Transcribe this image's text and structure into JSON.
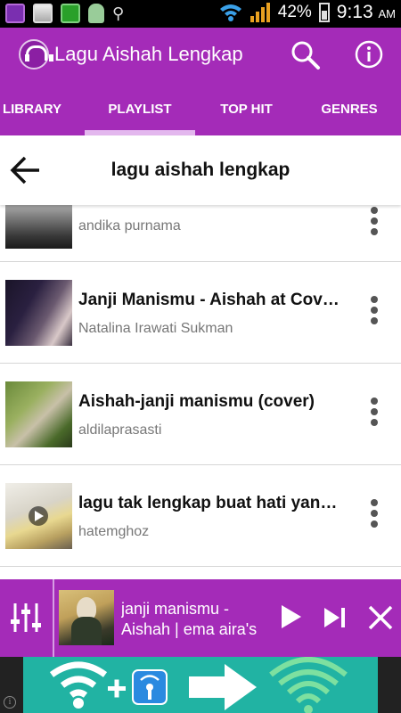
{
  "status_bar": {
    "battery_percent": "42%",
    "time": "9:13",
    "ampm": "AM"
  },
  "app_bar": {
    "title": "Lagu Aishah Lengkap",
    "icons": [
      "search-icon",
      "info-icon"
    ]
  },
  "tabs": [
    {
      "label": "LIBRARY",
      "selected": false
    },
    {
      "label": "PLAYLIST",
      "selected": true
    },
    {
      "label": "TOP HIT",
      "selected": false
    },
    {
      "label": "GENRES",
      "selected": false
    }
  ],
  "list_header": {
    "title": "lagu aishah lengkap"
  },
  "items": [
    {
      "title": "",
      "subtitle": "andika purnama"
    },
    {
      "title": "Janji Manismu - Aishah at Cover…",
      "subtitle": "Natalina Irawati Sukman"
    },
    {
      "title": "Aishah-janji manismu (cover)",
      "subtitle": "aldilaprasasti"
    },
    {
      "title": "lagu tak lengkap buat hati yang t…",
      "subtitle": "hatemghoz"
    }
  ],
  "player": {
    "line1": "janji manismu -",
    "line2": "Aishah | ema aira's"
  },
  "colors": {
    "primary": "#a42bb8",
    "tab_indicator": "#e3b7ee",
    "ad_background": "#21b3a3"
  }
}
